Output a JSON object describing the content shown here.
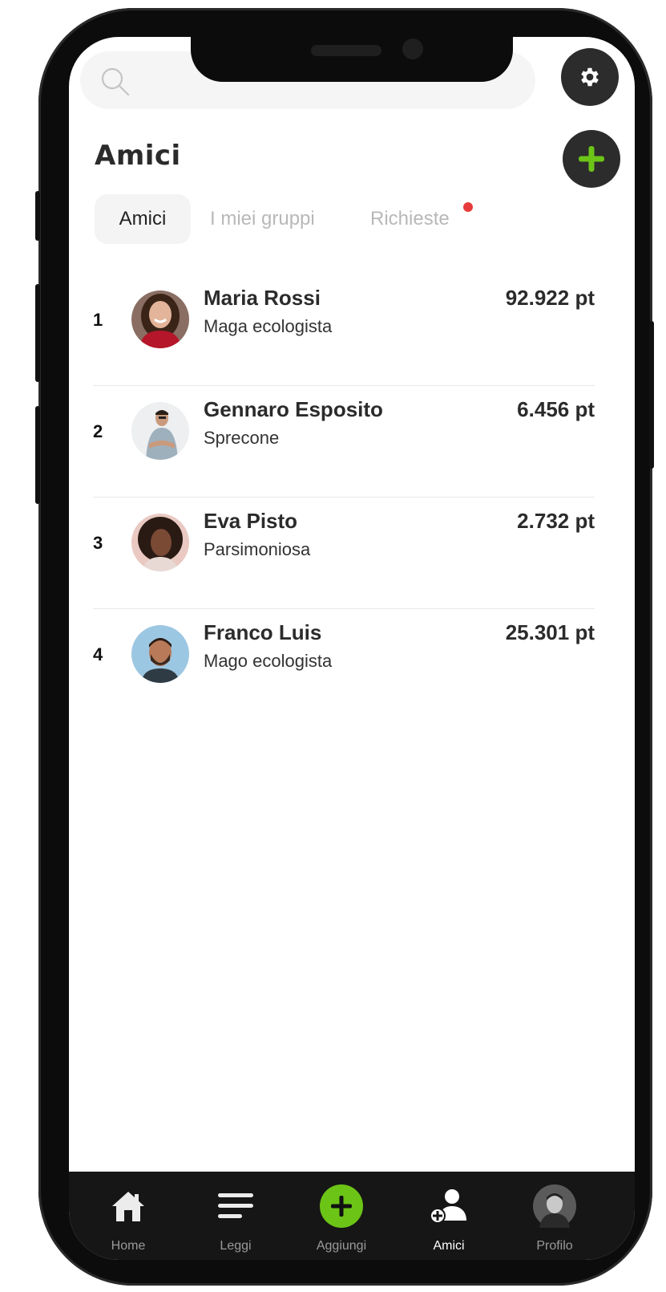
{
  "search": {
    "placeholder": ""
  },
  "header": {
    "title": "Amici"
  },
  "tabs": [
    {
      "label": "Amici",
      "active": true
    },
    {
      "label": "I miei gruppi",
      "active": false
    },
    {
      "label": "Richieste",
      "active": false,
      "has_notification": true
    }
  ],
  "friends": [
    {
      "rank": "1",
      "name": "Maria Rossi",
      "role": "Maga ecologista",
      "points": "92.922 pt"
    },
    {
      "rank": "2",
      "name": "Gennaro Esposito",
      "role": "Sprecone",
      "points": "6.456 pt"
    },
    {
      "rank": "3",
      "name": "Eva Pisto",
      "role": "Parsimoniosa",
      "points": "2.732 pt"
    },
    {
      "rank": "4",
      "name": "Franco Luis",
      "role": "Mago ecologista",
      "points": "25.301 pt"
    }
  ],
  "nav": [
    {
      "label": "Home",
      "icon": "home-icon"
    },
    {
      "label": "Leggi",
      "icon": "menu-icon"
    },
    {
      "label": "Aggiungi",
      "icon": "plus-icon"
    },
    {
      "label": "Amici",
      "icon": "add-friend-icon",
      "active": true
    },
    {
      "label": "Profilo",
      "icon": "avatar"
    }
  ],
  "colors": {
    "accent_green": "#6cc417",
    "dark_button": "#2c2c2c",
    "notification": "#e73a3a",
    "nav_background": "#161616"
  }
}
